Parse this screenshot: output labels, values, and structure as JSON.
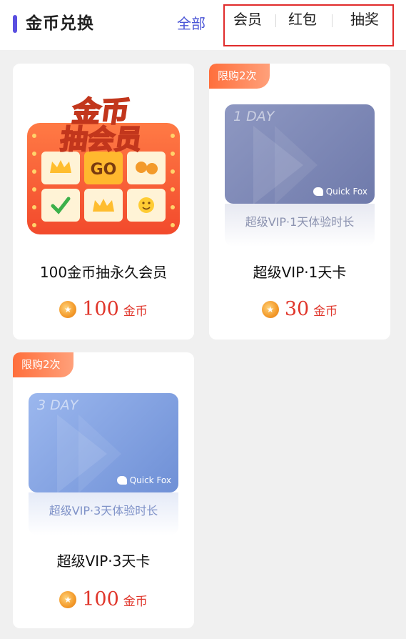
{
  "header": {
    "title": "金币兑换",
    "tab_all": "全部",
    "filters": [
      "会员",
      "红包",
      "抽奖"
    ]
  },
  "cards": [
    {
      "name": "100金币抽永久会员",
      "price": "100",
      "unit": "金币",
      "graphic": {
        "title_line1": "金币",
        "title_line2": "抽会员",
        "go_label": "GO"
      }
    },
    {
      "badge": "限购2次",
      "name": "超级VIP·1天卡",
      "price": "30",
      "unit": "金币",
      "graphic": {
        "days": "1 DAY",
        "brand": "Quick Fox",
        "caption": "超级VIP·1天体验时长"
      }
    },
    {
      "badge": "限购2次",
      "name": "超级VIP·3天卡",
      "price": "100",
      "unit": "金币",
      "graphic": {
        "days": "3 DAY",
        "brand": "Quick Fox",
        "caption": "超级VIP·3天体验时长"
      }
    }
  ],
  "colors": {
    "accent": "#4a55d6",
    "price": "#e0362b",
    "filter_highlight": "#e02b2b",
    "badge": "#ff6f3c"
  },
  "icons": {
    "coin": "coin-icon",
    "brand_logo": "fox-logo-icon"
  }
}
